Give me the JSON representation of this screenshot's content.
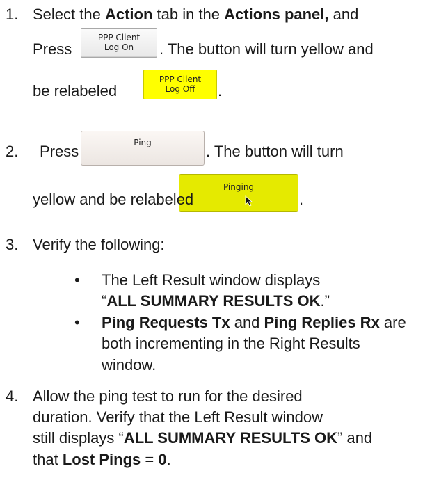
{
  "steps": [
    {
      "number": "1.",
      "line1": {
        "a": "Select the ",
        "b1": "Action",
        "c": " tab in the ",
        "b2": "Actions panel,",
        "d": " and"
      },
      "line2": {
        "a": "Press",
        "b": ".  The button will turn yellow and"
      },
      "line3": {
        "a": "be relabeled",
        "b": "."
      }
    },
    {
      "number": "2.",
      "line1": {
        "a": "Press",
        "b": ".  The button will turn"
      },
      "line2": {
        "a": "yellow and be relabeled",
        "b": "."
      }
    },
    {
      "number": "3.",
      "line1": "Verify the following:",
      "bullets": [
        {
          "glyph": "•",
          "l1_a": "The Left Result window displays",
          "l2_q1": "“",
          "l2_b": "ALL SUMMARY RESULTS OK",
          "l2_c": ".”"
        },
        {
          "glyph": "•",
          "l1_b1": "Ping Requests Tx",
          "l1_a": " and ",
          "l1_b2": "Ping Replies Rx",
          "l1_c": " are",
          "l2": "both incrementing in the Right Results",
          "l3": "window."
        }
      ]
    },
    {
      "number": "4.",
      "line1": "Allow the ping test to run for the desired",
      "line2": "duration.  Verify that the Left Result window",
      "line3": {
        "a": "still displays “",
        "b": "ALL SUMMARY RESULTS OK",
        "c": "” and"
      },
      "line4": {
        "a": "that ",
        "b": "Lost Pings",
        "c": " = ",
        "d": "0",
        "e": "."
      }
    }
  ],
  "buttons": {
    "ppp_log_on": {
      "line1": "PPP Client",
      "line2": "Log On",
      "color": "#e9e9e9"
    },
    "ppp_log_off": {
      "line1": "PPP Client",
      "line2": "Log Off",
      "color": "#ffff00"
    },
    "ping": {
      "label": "Ping",
      "color": "#f4efec"
    },
    "pinging": {
      "label": "Pinging",
      "color": "#e5ea00"
    }
  }
}
